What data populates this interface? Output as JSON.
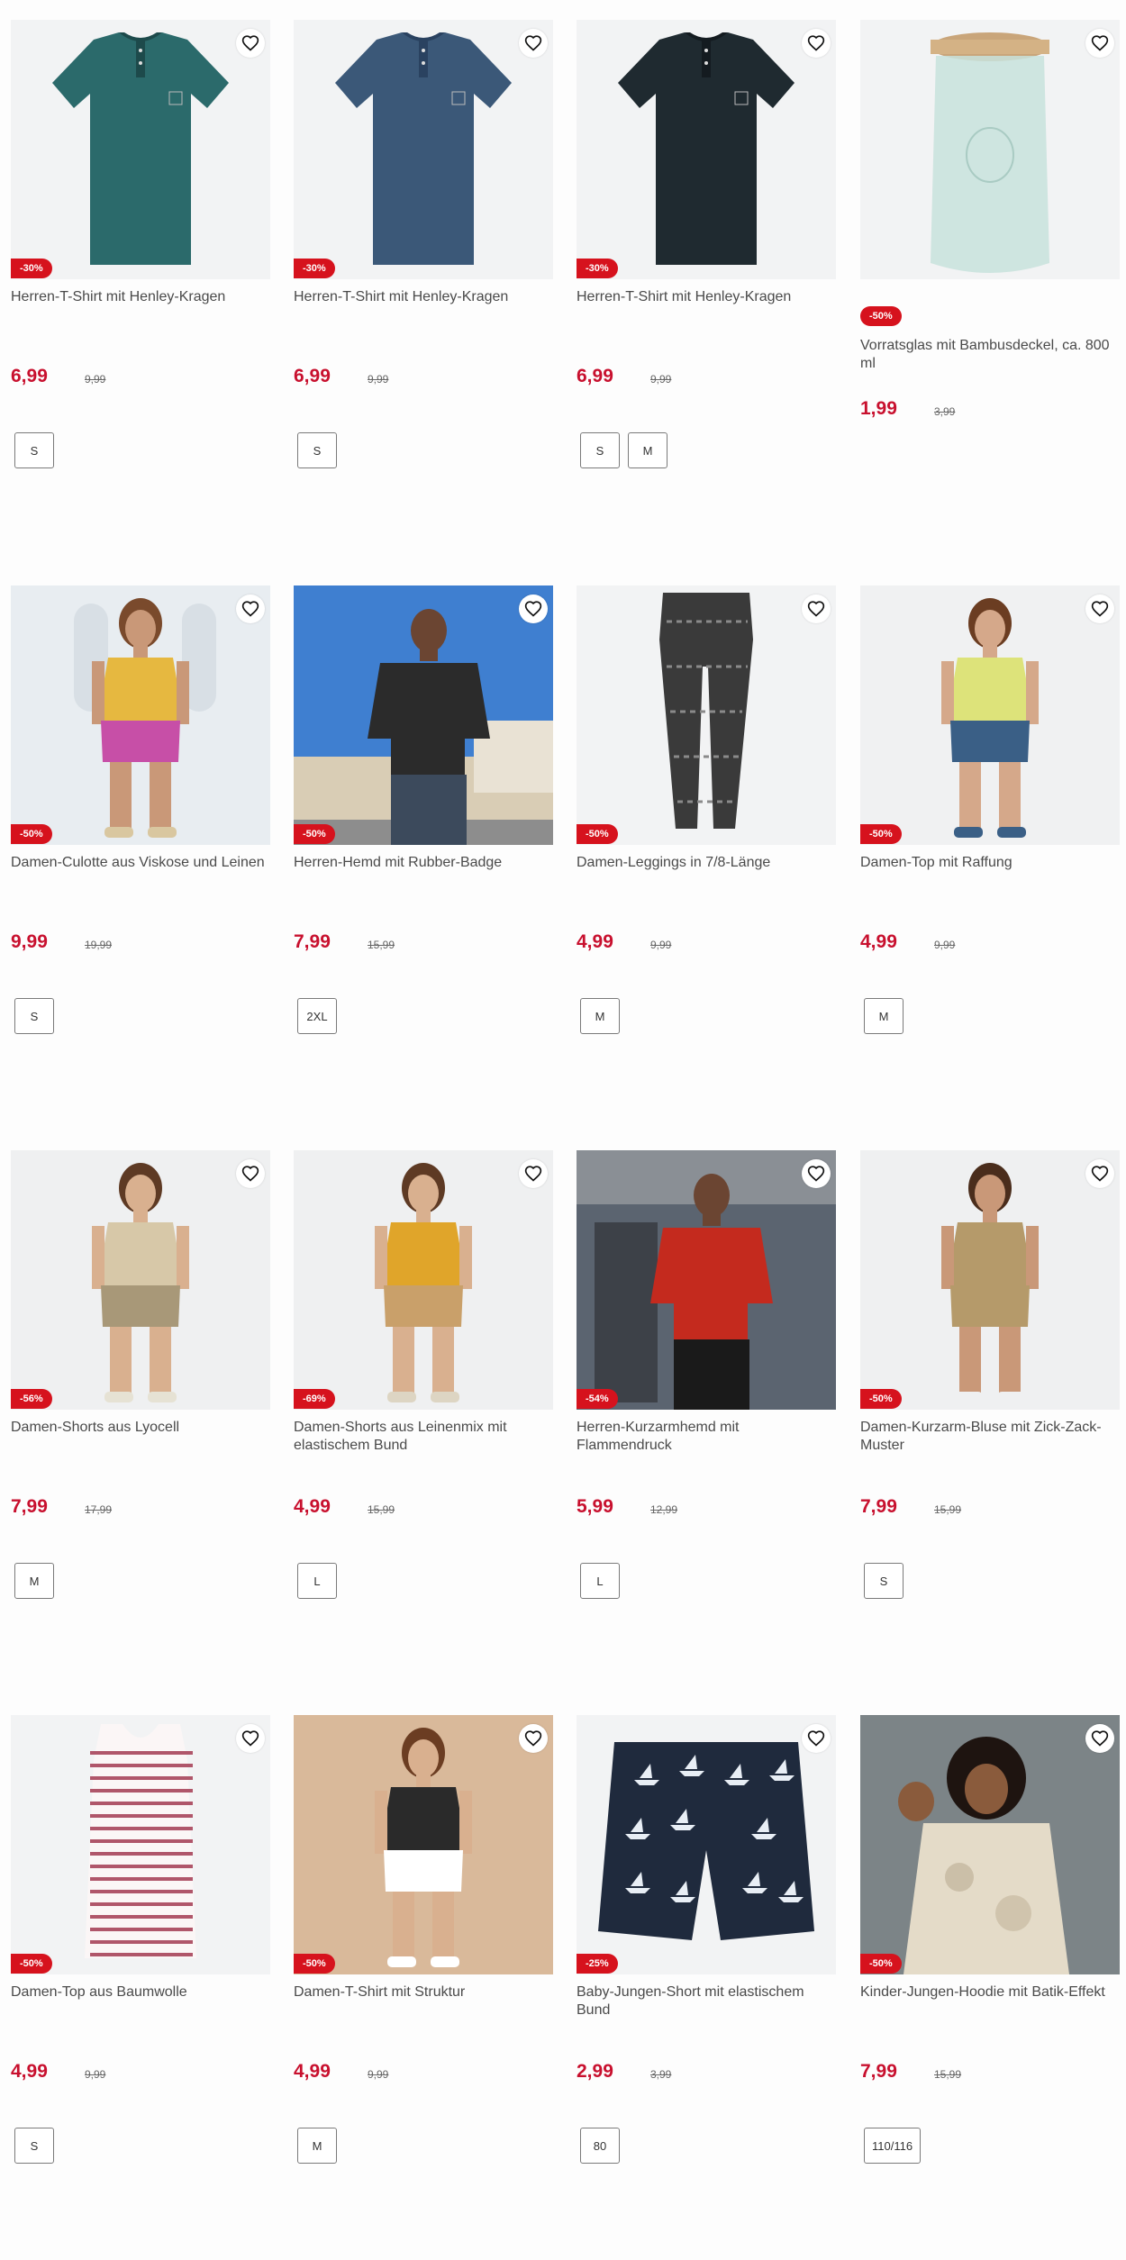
{
  "icons": {
    "wishlist": "heart-outline-icon"
  },
  "colors": {
    "discount_badge": "#d6121d",
    "price": "#c8102e"
  },
  "products": [
    {
      "title": "Herren-T-Shirt mit Henley-Kragen",
      "price": "6,99",
      "old_price": "9,99",
      "discount": "-30%",
      "sizes": [
        "S"
      ],
      "image": "henley-teal"
    },
    {
      "title": "Herren-T-Shirt mit Henley-Kragen",
      "price": "6,99",
      "old_price": "9,99",
      "discount": "-30%",
      "sizes": [
        "S"
      ],
      "image": "henley-blue"
    },
    {
      "title": "Herren-T-Shirt mit Henley-Kragen",
      "price": "6,99",
      "old_price": "9,99",
      "discount": "-30%",
      "sizes": [
        "S",
        "M"
      ],
      "image": "henley-black"
    },
    {
      "title": "Vorratsglas mit Bambusdeckel, ca. 800 ml",
      "price": "1,99",
      "old_price": "3,99",
      "discount": "-50%",
      "sizes": [],
      "image": "jar"
    },
    {
      "title": "Damen-Culotte aus Viskose und Leinen",
      "price": "9,99",
      "old_price": "19,99",
      "discount": "-50%",
      "sizes": [
        "S"
      ],
      "image": "woman-culotte"
    },
    {
      "title": "Herren-Hemd mit Rubber-Badge",
      "price": "7,99",
      "old_price": "15,99",
      "discount": "-50%",
      "sizes": [
        "2XL"
      ],
      "image": "man-shirt-street"
    },
    {
      "title": "Damen-Leggings in 7/8-Länge",
      "price": "4,99",
      "old_price": "9,99",
      "discount": "-50%",
      "sizes": [
        "M"
      ],
      "image": "leggings"
    },
    {
      "title": "Damen-Top mit Raffung",
      "price": "4,99",
      "old_price": "9,99",
      "discount": "-50%",
      "sizes": [
        "M"
      ],
      "image": "woman-top-yellow"
    },
    {
      "title": "Damen-Shorts aus Lyocell",
      "price": "7,99",
      "old_price": "17,99",
      "discount": "-56%",
      "sizes": [
        "M"
      ],
      "image": "woman-shorts-khaki"
    },
    {
      "title": "Damen-Shorts aus Leinenmix mit elastischem Bund",
      "price": "4,99",
      "old_price": "15,99",
      "discount": "-69%",
      "sizes": [
        "L"
      ],
      "image": "woman-shorts-print"
    },
    {
      "title": "Herren-Kurzarmhemd mit Flammendruck",
      "price": "5,99",
      "old_price": "12,99",
      "discount": "-54%",
      "sizes": [
        "L"
      ],
      "image": "man-flame-shirt"
    },
    {
      "title": "Damen-Kurzarm-Bluse mit Zick-Zack-Muster",
      "price": "7,99",
      "old_price": "15,99",
      "discount": "-50%",
      "sizes": [
        "S"
      ],
      "image": "woman-zigzag"
    },
    {
      "title": "Damen-Top aus Baumwolle",
      "price": "4,99",
      "old_price": "9,99",
      "discount": "-50%",
      "sizes": [
        "S"
      ],
      "image": "striped-top"
    },
    {
      "title": "Damen-T-Shirt mit Struktur",
      "price": "4,99",
      "old_price": "9,99",
      "discount": "-50%",
      "sizes": [
        "M"
      ],
      "image": "woman-striped-tee"
    },
    {
      "title": "Baby-Jungen-Short mit elastischem Bund",
      "price": "2,99",
      "old_price": "3,99",
      "discount": "-25%",
      "sizes": [
        "80"
      ],
      "image": "baby-shorts"
    },
    {
      "title": "Kinder-Jungen-Hoodie mit Batik-Effekt",
      "price": "7,99",
      "old_price": "15,99",
      "discount": "-50%",
      "sizes": [
        "110/116"
      ],
      "image": "kid-hoodie"
    }
  ]
}
